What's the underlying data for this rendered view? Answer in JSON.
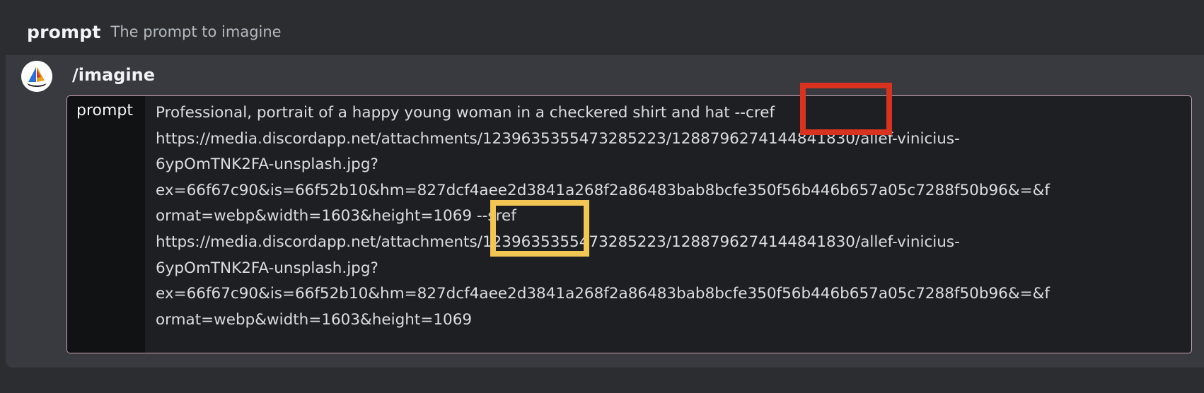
{
  "option": {
    "name": "prompt",
    "description": "The prompt to imagine"
  },
  "command": {
    "name": "/imagine",
    "avatar_icon": "midjourney-sailboat-icon"
  },
  "input": {
    "param_label": "prompt",
    "value_lines": [
      "Professional, portrait of a happy young woman in a checkered shirt and hat --cref",
      "https://media.discordapp.net/attachments/1239635355473285223/1288796274144841830/allef-vinicius-",
      "6ypOmTNK2FA-unsplash.jpg?",
      "ex=66f67c90&is=66f52b10&hm=827dcf4aee2d3841a268f2a86483bab8bcfe350f56b446b657a05c7288f50b96&=&f",
      "ormat=webp&width=1603&height=1069 --sref",
      "https://media.discordapp.net/attachments/1239635355473285223/1288796274144841830/allef-vinicius-",
      "6ypOmTNK2FA-unsplash.jpg?",
      "ex=66f67c90&is=66f52b10&hm=827dcf4aee2d3841a268f2a86483bab8bcfe350f56b446b657a05c7288f50b96&=&f",
      "ormat=webp&width=1603&height=1069"
    ]
  },
  "annotations": {
    "cref_color": "#d9331f",
    "sref_color": "#f2c655"
  }
}
